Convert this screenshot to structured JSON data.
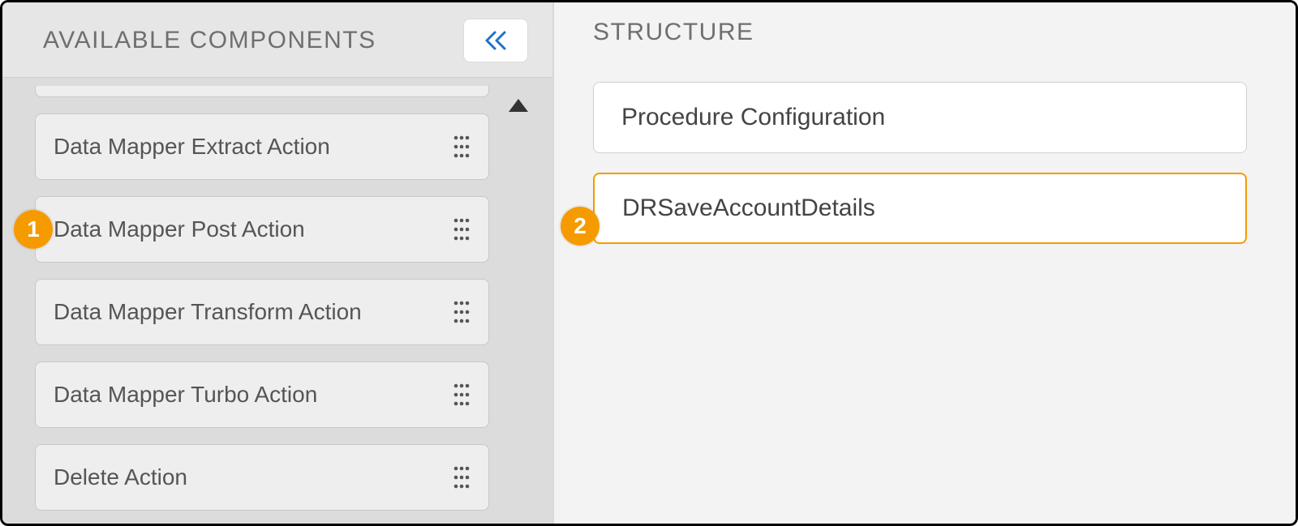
{
  "left": {
    "title": "AVAILABLE COMPONENTS",
    "components": [
      {
        "label": "Data Mapper Extract Action"
      },
      {
        "label": "Data Mapper Post Action"
      },
      {
        "label": "Data Mapper Transform Action"
      },
      {
        "label": "Data Mapper Turbo Action"
      },
      {
        "label": "Delete Action"
      }
    ]
  },
  "right": {
    "title": "STRUCTURE",
    "items": [
      {
        "label": "Procedure Configuration",
        "selected": false
      },
      {
        "label": "DRSaveAccountDetails",
        "selected": true
      }
    ]
  },
  "callouts": {
    "one": "1",
    "two": "2"
  },
  "colors": {
    "accent": "#f59b00",
    "chevron": "#1b73c9"
  }
}
